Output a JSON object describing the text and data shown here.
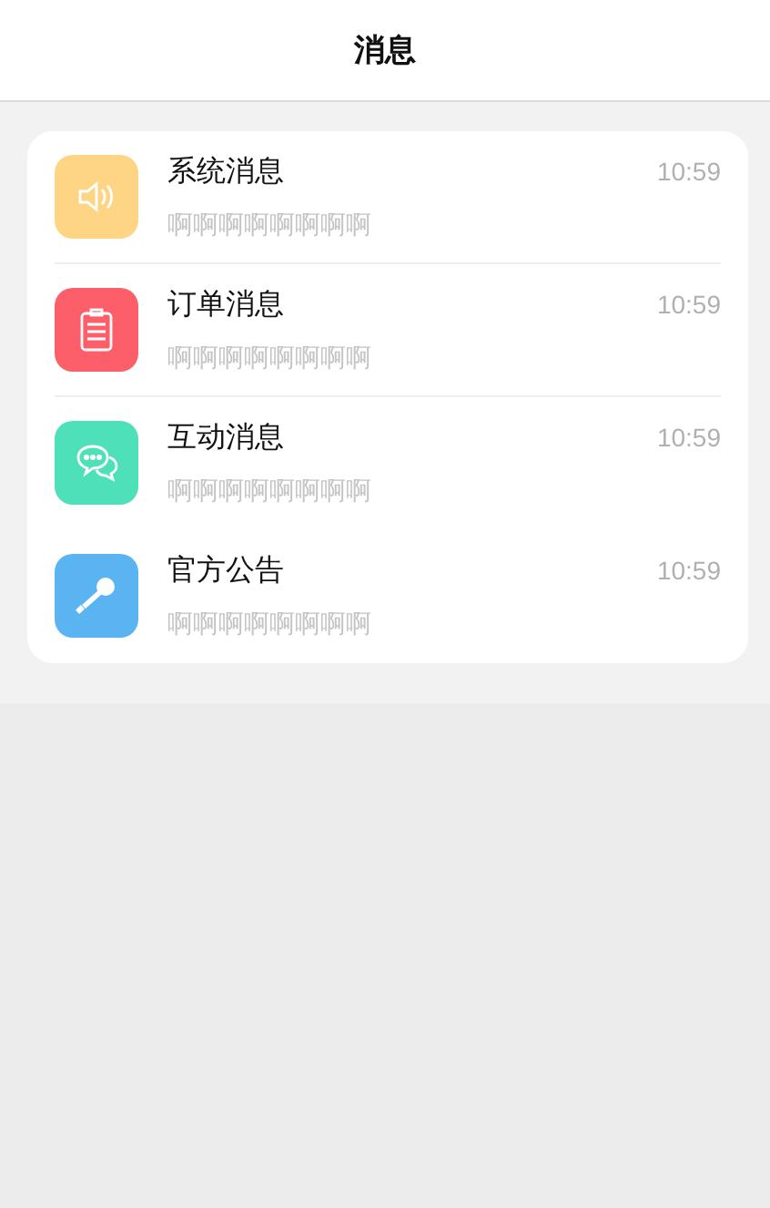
{
  "header": {
    "title": "消息"
  },
  "messages": [
    {
      "kind": "speaker",
      "color": "#fdd585",
      "title": "系统消息",
      "time": "10:59",
      "preview": "啊啊啊啊啊啊啊啊",
      "divider": true
    },
    {
      "kind": "clipboard",
      "color": "#fc5e6a",
      "title": "订单消息",
      "time": "10:59",
      "preview": "啊啊啊啊啊啊啊啊",
      "divider": true
    },
    {
      "kind": "chat",
      "color": "#4de0b9",
      "title": "互动消息",
      "time": "10:59",
      "preview": "啊啊啊啊啊啊啊啊",
      "divider": false
    },
    {
      "kind": "microphone",
      "color": "#5ab4f2",
      "title": "官方公告",
      "time": "10:59",
      "preview": "啊啊啊啊啊啊啊啊",
      "divider": false
    }
  ]
}
